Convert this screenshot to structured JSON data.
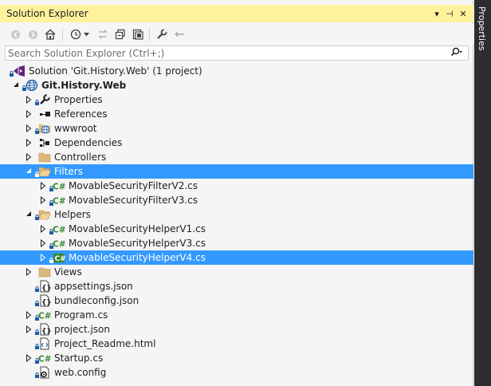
{
  "title": "Solution Explorer",
  "title_buttons": {
    "dropdown": "▾",
    "pin": "⊣",
    "close": "✕"
  },
  "search_placeholder": "Search Solution Explorer (Ctrl+;)",
  "side_tab": "Properties",
  "tree": [
    {
      "label": "Solution 'Git.History.Web' (1 project)",
      "icon": "solution-icon",
      "depth": 0,
      "expander": "none",
      "lock": true,
      "bold": false,
      "selected": false
    },
    {
      "label": "Git.History.Web",
      "icon": "web-project-icon",
      "depth": 0,
      "expander": "open",
      "lock": true,
      "bold": true,
      "selected": false
    },
    {
      "label": "Properties",
      "icon": "wrench-icon",
      "depth": 1,
      "expander": "closed",
      "lock": true,
      "bold": false,
      "selected": false
    },
    {
      "label": "References",
      "icon": "references-icon",
      "depth": 1,
      "expander": "closed",
      "lock": false,
      "bold": false,
      "selected": false
    },
    {
      "label": "wwwroot",
      "icon": "globe-folder-icon",
      "depth": 1,
      "expander": "closed",
      "lock": true,
      "bold": false,
      "selected": false
    },
    {
      "label": "Dependencies",
      "icon": "dependencies-icon",
      "depth": 1,
      "expander": "closed",
      "lock": false,
      "bold": false,
      "selected": false
    },
    {
      "label": "Controllers",
      "icon": "folder-icon",
      "depth": 1,
      "expander": "closed",
      "lock": false,
      "bold": false,
      "selected": false
    },
    {
      "label": "Filters",
      "icon": "open-folder-icon",
      "depth": 1,
      "expander": "open",
      "lock": true,
      "bold": false,
      "selected": true
    },
    {
      "label": "MovableSecurityFilterV2.cs",
      "icon": "csharp-file-icon",
      "depth": 2,
      "expander": "closed",
      "lock": true,
      "bold": false,
      "selected": false
    },
    {
      "label": "MovableSecurityFilterV3.cs",
      "icon": "csharp-file-icon",
      "depth": 2,
      "expander": "closed",
      "lock": true,
      "bold": false,
      "selected": false
    },
    {
      "label": "Helpers",
      "icon": "open-folder-icon",
      "depth": 1,
      "expander": "open",
      "lock": true,
      "bold": false,
      "selected": false
    },
    {
      "label": "MovableSecurityHelperV1.cs",
      "icon": "csharp-file-icon",
      "depth": 2,
      "expander": "closed",
      "lock": true,
      "bold": false,
      "selected": false
    },
    {
      "label": "MovableSecurityHelperV3.cs",
      "icon": "csharp-file-icon",
      "depth": 2,
      "expander": "closed",
      "lock": true,
      "bold": false,
      "selected": false
    },
    {
      "label": "MovableSecurityHelperV4.cs",
      "icon": "csharp-file-icon",
      "depth": 2,
      "expander": "closed",
      "lock": true,
      "bold": false,
      "selected": true
    },
    {
      "label": "Views",
      "icon": "folder-icon",
      "depth": 1,
      "expander": "closed",
      "lock": false,
      "bold": false,
      "selected": false
    },
    {
      "label": "appsettings.json",
      "icon": "json-file-icon",
      "depth": 1,
      "expander": "none",
      "lock": true,
      "bold": false,
      "selected": false
    },
    {
      "label": "bundleconfig.json",
      "icon": "json-file-icon",
      "depth": 1,
      "expander": "none",
      "lock": true,
      "bold": false,
      "selected": false
    },
    {
      "label": "Program.cs",
      "icon": "csharp-file-icon",
      "depth": 1,
      "expander": "closed",
      "lock": true,
      "bold": false,
      "selected": false
    },
    {
      "label": "project.json",
      "icon": "json-file-icon",
      "depth": 1,
      "expander": "closed",
      "lock": true,
      "bold": false,
      "selected": false
    },
    {
      "label": "Project_Readme.html",
      "icon": "html-file-icon",
      "depth": 1,
      "expander": "none",
      "lock": true,
      "bold": false,
      "selected": false
    },
    {
      "label": "Startup.cs",
      "icon": "csharp-file-icon",
      "depth": 1,
      "expander": "closed",
      "lock": true,
      "bold": false,
      "selected": false
    },
    {
      "label": "web.config",
      "icon": "config-file-icon",
      "depth": 1,
      "expander": "none",
      "lock": true,
      "bold": false,
      "selected": false
    }
  ]
}
